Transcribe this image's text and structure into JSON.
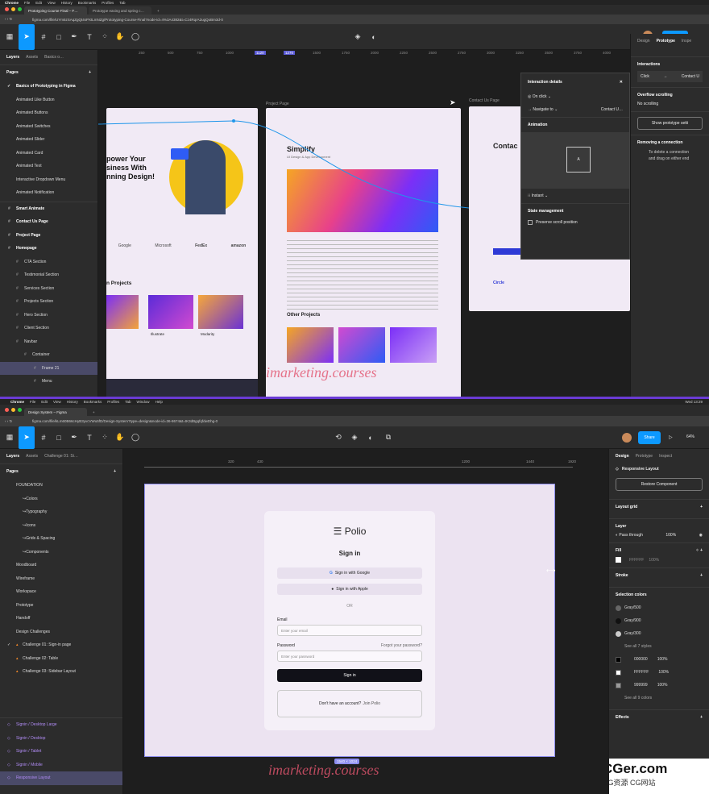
{
  "top": {
    "menubar": [
      "Chrome",
      "File",
      "Edit",
      "View",
      "History",
      "Bookmarks",
      "Profiles",
      "Tab"
    ],
    "tabs": [
      "Prototyping Course Final – F…",
      "Prototype easing and spring c…"
    ],
    "url": "figma.com/file/UYm5zSAqZgQt4sPXtLmNZg/Prototyping-Course-Final?node-id=4%3A4382&t=Cz4RqrA2ugQoBm3d-0",
    "share": "Share",
    "layers_tab": "Layers",
    "assets_tab": "Assets",
    "page_tab": "Basics o…",
    "pages_label": "Pages",
    "pages": [
      "Basics of Prototyping in Figma",
      "Animated Like Button",
      "Animated Buttons",
      "Animated Switches",
      "Animated Slider",
      "Animated Card",
      "Animated Text",
      "Interactive Dropdown Menu",
      "Animated Notification"
    ],
    "layers": [
      "Smart Animate",
      "Contact Us Page",
      "Project Page",
      "Homepage",
      "CTA Section",
      "Testimonial Section",
      "Services Section",
      "Projects Section",
      "Hero Section",
      "Client Section",
      "Navbar",
      "Container",
      "Frame 21",
      "Menu"
    ],
    "ruler": [
      "250",
      "500",
      "750",
      "1000",
      "1120",
      "1270",
      "1500",
      "1750",
      "2000",
      "2250",
      "2500",
      "2750",
      "3000",
      "3250",
      "3500",
      "3750",
      "4000"
    ],
    "frames": {
      "project_label": "Project Page",
      "contact_label": "Contact Us Page",
      "hero_text": "power Your\nsiness With\nnning Design!",
      "projects_heading": "n Projects",
      "simplify_title": "Simplify",
      "simplify_sub": "UI Design & App Development",
      "other_projects": "Other Projects",
      "circle": "Circle",
      "contact_heading": "Contac",
      "logos": [
        "Google",
        "Microsoft",
        "FedEx",
        "amazon"
      ],
      "card_titles": [
        "Illustrate",
        "Modarity"
      ]
    },
    "interaction": {
      "title": "Interaction details",
      "trigger": "On click",
      "action": "Navigate to",
      "destination": "Contact U…",
      "animation_label": "Animation",
      "animation_type": "Instant",
      "state_label": "State management",
      "preserve": "Preserve scroll position"
    },
    "right": {
      "tabs": [
        "Design",
        "Prototype",
        "Inspe"
      ],
      "interactions": "Interactions",
      "click": "Click",
      "contact": "Contact U",
      "overflow": "Overflow scrolling",
      "no_scrolling": "No scrolling",
      "show_settings": "Show prototype setti",
      "removing": "Removing a connection",
      "remove_text": "To delete a connection\nand drag on either end"
    }
  },
  "bottom": {
    "menubar": [
      "Chrome",
      "File",
      "Edit",
      "View",
      "History",
      "Bookmarks",
      "Profiles",
      "Tab",
      "Window",
      "Help"
    ],
    "clock": "Wed 13:29",
    "tab": "Design System – Figma",
    "url": "figma.com/file/kLm60B66cHyB3yvcVWu5fD/Design-System?type=design&node-id=36-8674&t=tK3dBgqfqfdwDhg-0",
    "share": "Share",
    "zoom": "64%",
    "layers_tab": "Layers",
    "assets_tab": "Assets",
    "page_tab": "Challenge 01: Si…",
    "pages_label": "Pages",
    "pages": [
      "FOUNDATION",
      "↪Colors",
      "↪Typography",
      "↪Icons",
      "↪Grids & Spacing",
      "↪Components",
      "Moodboard",
      "Wireframe",
      "Workspace",
      "Prototype",
      "Handoff",
      "Design Challenges",
      "Challenge 01: Sign-in page",
      "Challenge 02: Table",
      "Challenge 03: Sidebar Layout"
    ],
    "frames": [
      "Signin / Desktop Large",
      "Signin / Desktop",
      "Signin / Tablet",
      "Signin / Mobile",
      "Responsive Layout"
    ],
    "ruler": [
      "320",
      "430",
      "1200",
      "1440",
      "1920"
    ],
    "frame_size": "1540 × 1024",
    "signin": {
      "logo": "Polio",
      "title": "Sign in",
      "google": "Sign in with Google",
      "apple": "Sign in with Apple",
      "or": "OR",
      "email_label": "Email",
      "email_ph": "Enter your email",
      "password_label": "Password",
      "forgot": "Forgot your password?",
      "password_ph": "Enter your password",
      "button": "Sign in",
      "no_account": "Don't have an account?",
      "join": "Join Polio"
    },
    "right": {
      "tabs": [
        "Design",
        "Prototype",
        "Inspect"
      ],
      "component": "Responsive Layout",
      "restore": "Restore Component",
      "layout_grid": "Layout grid",
      "layer": "Layer",
      "pass_through": "Pass through",
      "layer_opacity": "100%",
      "fill": "Fill",
      "fill_hex": "FFFFFF",
      "fill_opacity": "100%",
      "stroke": "Stroke",
      "selection_colors": "Selection colors",
      "styles": [
        "Gray/500",
        "Gray/900",
        "Gray/300"
      ],
      "see_styles": "See all 7 styles",
      "colors": [
        {
          "hex": "000000",
          "opacity": "100%",
          "swatch": "#000000"
        },
        {
          "hex": "FFFFFF",
          "opacity": "100%",
          "swatch": "#ffffff"
        },
        {
          "hex": "999999",
          "opacity": "100%",
          "swatch": "#999999"
        }
      ],
      "see_colors": "See all 9 colors",
      "effects": "Effects"
    }
  },
  "watermark": "imarketing.courses",
  "cg_logo": "CGer.com",
  "cg_sub": "CG资源 CG网站"
}
